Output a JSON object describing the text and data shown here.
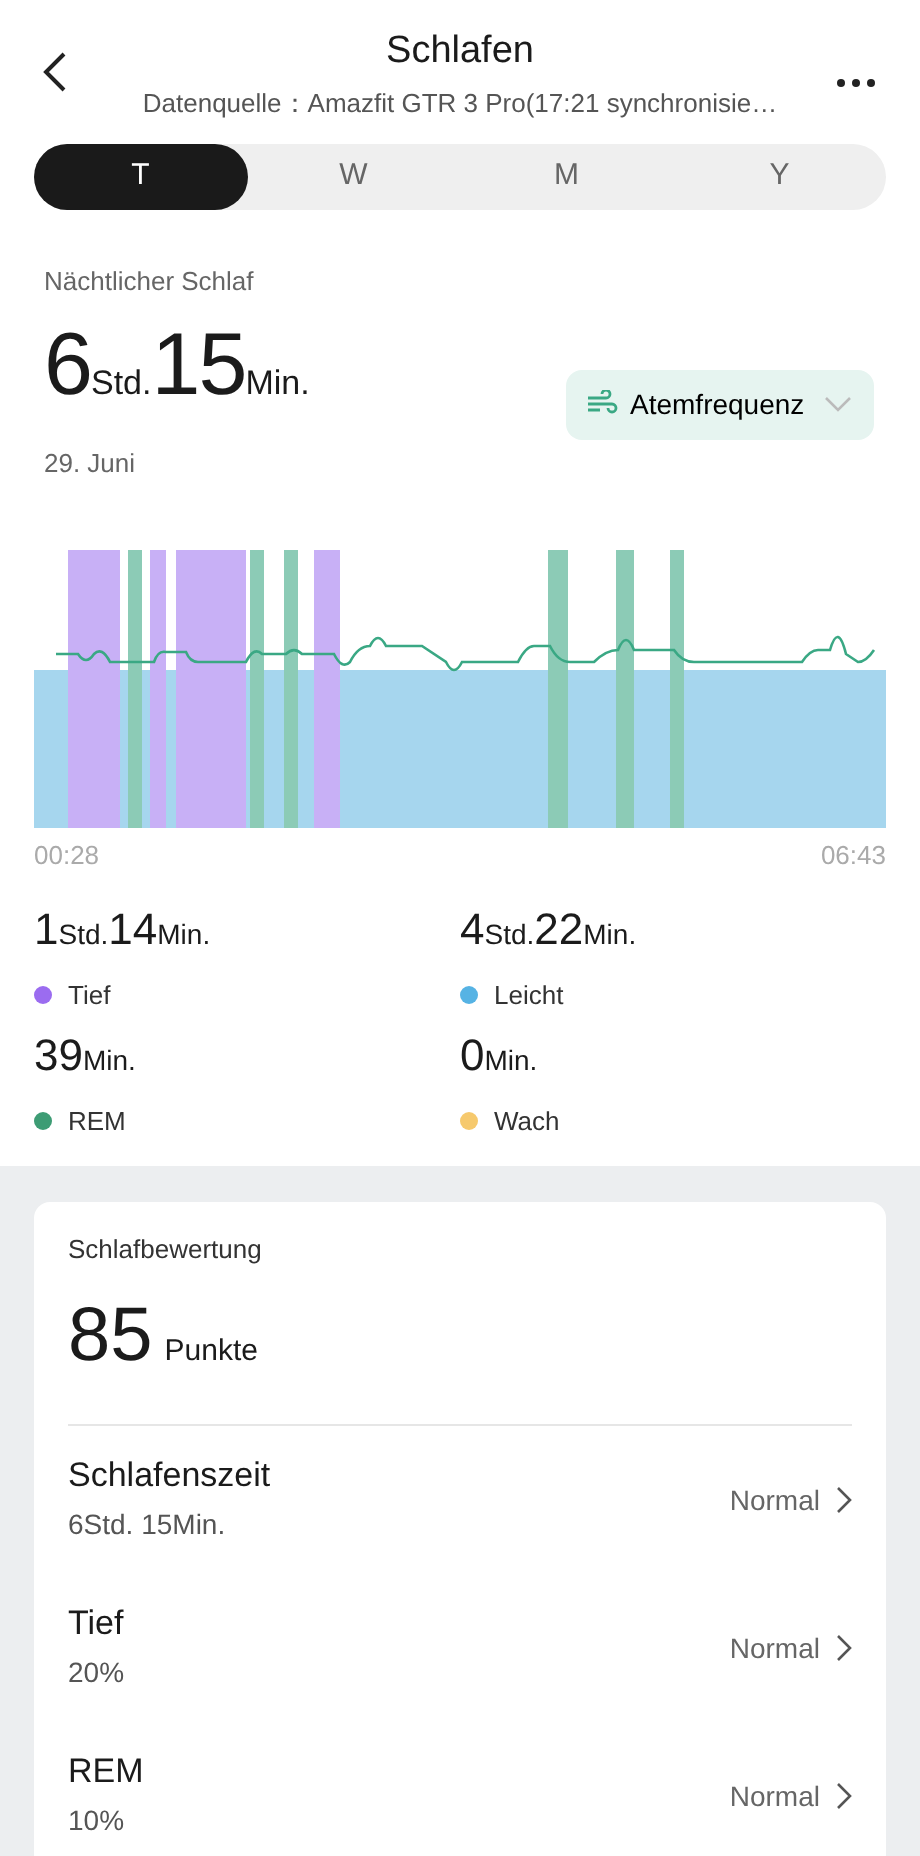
{
  "header": {
    "title": "Schlafen",
    "source": "Datenquelle：Amazfit GTR 3 Pro(17:21 synchronisie…"
  },
  "tabs": [
    {
      "label": "T",
      "selected": true
    },
    {
      "label": "W",
      "selected": false
    },
    {
      "label": "M",
      "selected": false
    },
    {
      "label": "Y",
      "selected": false
    }
  ],
  "summary": {
    "caption": "Nächtlicher Schlaf",
    "duration": [
      {
        "num": "6",
        "unit": "Std."
      },
      {
        "num": "15",
        "unit": "Min."
      }
    ],
    "date": "29. Juni",
    "dropdown": "Atemfrequenz"
  },
  "chart": {
    "start": "00:28",
    "end": "06:43"
  },
  "stages": [
    {
      "duration": [
        {
          "num": "1",
          "unit": "Std."
        },
        {
          "num": "14",
          "unit": "Min."
        }
      ],
      "label": "Tief",
      "color": "#9b6cf0"
    },
    {
      "duration": [
        {
          "num": "4",
          "unit": "Std."
        },
        {
          "num": "22",
          "unit": "Min."
        }
      ],
      "label": "Leicht",
      "color": "#56b3e4"
    },
    {
      "duration": [
        {
          "num": "39",
          "unit": "Min."
        }
      ],
      "label": "REM",
      "color": "#3d9c74"
    },
    {
      "duration": [
        {
          "num": "0",
          "unit": "Min."
        }
      ],
      "label": "Wach",
      "color": "#f6c96d"
    }
  ],
  "score": {
    "title": "Schlafbewertung",
    "value": "85",
    "unit": "Punkte",
    "items": [
      {
        "label": "Schlafenszeit",
        "value": "6Std. 15Min.",
        "status": "Normal"
      },
      {
        "label": "Tief",
        "value": "20%",
        "status": "Normal"
      },
      {
        "label": "REM",
        "value": "10%",
        "status": "Normal"
      }
    ]
  }
}
